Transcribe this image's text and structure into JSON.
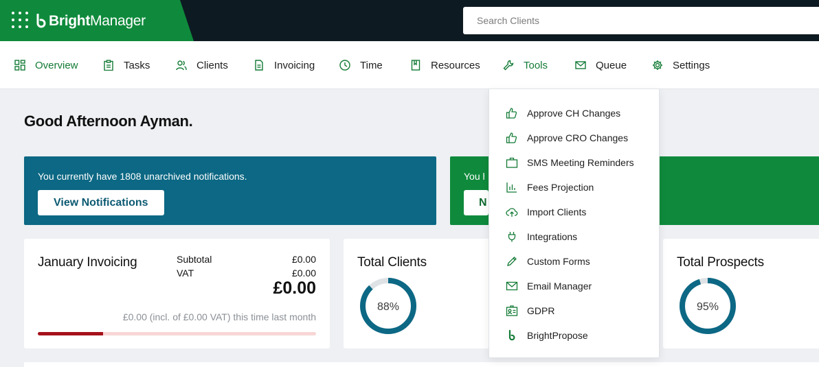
{
  "brand": {
    "name_bold": "Bright",
    "name_regular": "Manager"
  },
  "search": {
    "placeholder": "Search Clients"
  },
  "nav": {
    "items": [
      {
        "label": "Overview",
        "icon": "grid-icon"
      },
      {
        "label": "Tasks",
        "icon": "clipboard-icon"
      },
      {
        "label": "Clients",
        "icon": "users-icon"
      },
      {
        "label": "Invoicing",
        "icon": "document-icon"
      },
      {
        "label": "Time",
        "icon": "clock-icon"
      },
      {
        "label": "Resources",
        "icon": "book-icon"
      },
      {
        "label": "Tools",
        "icon": "wrench-icon"
      },
      {
        "label": "Queue",
        "icon": "envelope-icon"
      },
      {
        "label": "Settings",
        "icon": "gear-icon"
      }
    ],
    "active": "Overview",
    "open": "Tools"
  },
  "greeting": "Good Afternoon Ayman.",
  "notifications_banner": {
    "text": "You currently have 1808 unarchived notifications.",
    "button": "View Notifications"
  },
  "second_banner": {
    "text_visible": "You h",
    "button_visible": "N"
  },
  "invoicing": {
    "title": "January Invoicing",
    "subtotal_label": "Subtotal",
    "subtotal_value": "£0.00",
    "vat_label": "VAT",
    "vat_value": "£0.00",
    "total": "£0.00",
    "last_month": "£0.00 (incl. of £0.00 VAT) this time last month",
    "progress_fraction": 0.235
  },
  "total_clients": {
    "title": "Total Clients",
    "percent_label": "88%",
    "percent": 88
  },
  "total_prospects": {
    "title": "Total Prospects",
    "percent_label": "95%",
    "percent": 95
  },
  "tools_menu": {
    "items": [
      {
        "label": "Approve CH Changes",
        "icon": "thumbs-up-icon"
      },
      {
        "label": "Approve CRO Changes",
        "icon": "thumbs-up-icon"
      },
      {
        "label": "SMS Meeting Reminders",
        "icon": "briefcase-icon"
      },
      {
        "label": "Fees Projection",
        "icon": "bar-chart-icon"
      },
      {
        "label": "Import Clients",
        "icon": "cloud-upload-icon"
      },
      {
        "label": "Integrations",
        "icon": "plug-icon"
      },
      {
        "label": "Custom Forms",
        "icon": "pencil-icon"
      },
      {
        "label": "Email Manager",
        "icon": "envelope-icon"
      },
      {
        "label": "GDPR",
        "icon": "id-card-icon"
      },
      {
        "label": "BrightPropose",
        "icon": "bright-logo-icon"
      }
    ]
  },
  "colors": {
    "brand_green": "#0f8a3c",
    "topbar_dark": "#0e1a22",
    "banner_blue": "#0c6884",
    "donut_blue": "#0c6884",
    "progress_red": "#a5111b",
    "active_green": "#127a35"
  }
}
